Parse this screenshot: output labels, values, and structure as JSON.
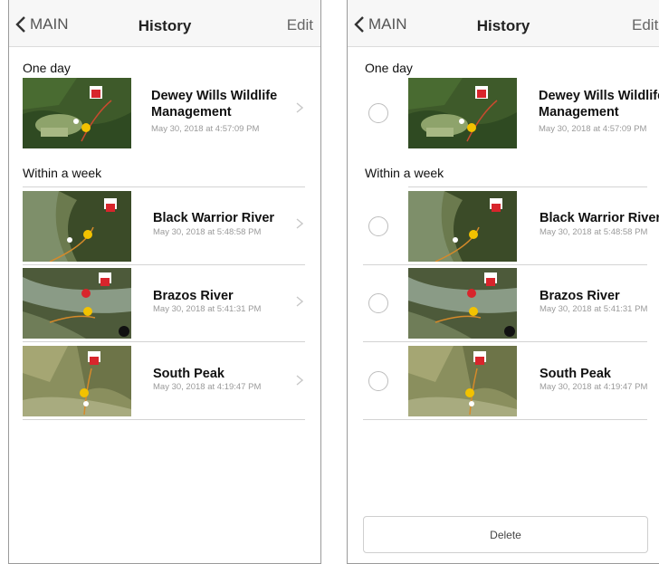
{
  "nav": {
    "back_label": "MAIN",
    "title": "History",
    "edit_label": "Edit"
  },
  "sections": {
    "one_day": "One day",
    "within_week": "Within a week"
  },
  "items": [
    {
      "title_line1": "Dewey Wills Wildlife",
      "title_line2": "Management",
      "date": "May 30, 2018 at 4:57:09 PM"
    },
    {
      "title_line1": "Black Warrior River",
      "date": "May 30, 2018 at 5:48:58 PM"
    },
    {
      "title_line1": "Brazos River",
      "date": "May 30, 2018 at 5:41:31 PM"
    },
    {
      "title_line1": "South Peak",
      "date": "May 30, 2018 at 4:19:47 PM"
    }
  ],
  "delete_label": "Delete",
  "colors": {
    "accent": "#f2c200",
    "marker_red": "#d8252c",
    "map_dark": "#2f4a22"
  }
}
